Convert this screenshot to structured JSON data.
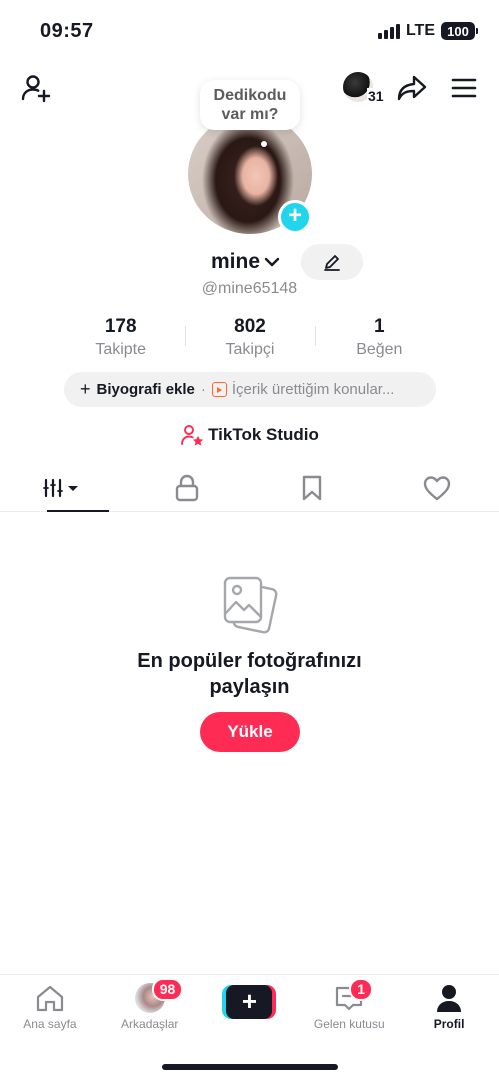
{
  "status_bar": {
    "time": "09:57",
    "network": "LTE",
    "battery": "100"
  },
  "top_bar": {
    "story_count": "31"
  },
  "bubble": {
    "line1": "Dedikodu",
    "line2": "var mı?"
  },
  "profile": {
    "display_name": "mine",
    "username": "@mine65148"
  },
  "stats": [
    {
      "value": "178",
      "label": "Takipte"
    },
    {
      "value": "802",
      "label": "Takipçi"
    },
    {
      "value": "1",
      "label": "Beğen"
    }
  ],
  "bio": {
    "add_label": "Biyografi ekle",
    "separator": "·",
    "topic_label": "İçerik ürettiğim konular..."
  },
  "studio": {
    "label": "TikTok Studio"
  },
  "empty_state": {
    "title_line1": "En popüler fotoğrafınızı",
    "title_line2": "paylaşın",
    "upload_label": "Yükle"
  },
  "bottom_nav": {
    "home": "Ana sayfa",
    "friends": "Arkadaşlar",
    "friends_badge": "98",
    "inbox": "Gelen kutusu",
    "inbox_badge": "1",
    "profile": "Profil"
  },
  "colors": {
    "accent": "#fe2c55",
    "cyan": "#20d5ec",
    "text": "#161823",
    "muted": "#8a8b91"
  }
}
